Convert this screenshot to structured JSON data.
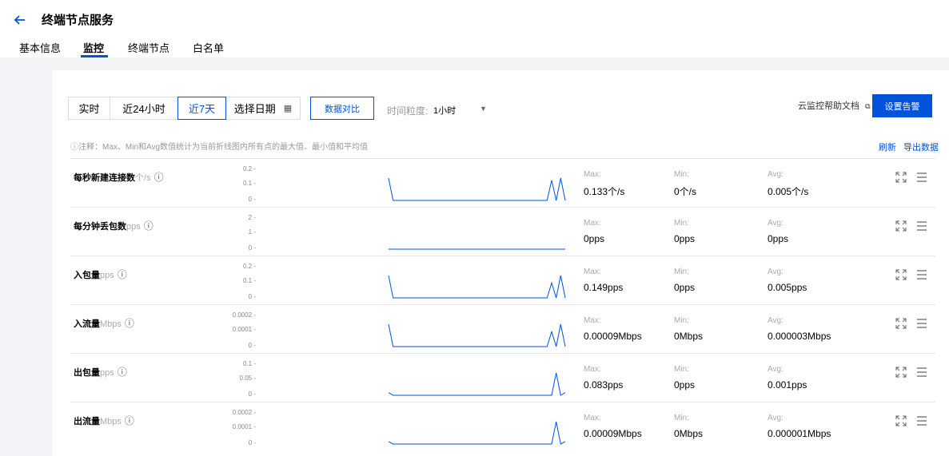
{
  "header": {
    "title": "终端节点服务",
    "tabs": [
      {
        "label": "基本信息"
      },
      {
        "label": "监控"
      },
      {
        "label": "终端节点"
      },
      {
        "label": "白名单"
      }
    ]
  },
  "toolbar": {
    "range_options": [
      {
        "label": "实时"
      },
      {
        "label": "近24小时"
      },
      {
        "label": "近7天"
      },
      {
        "label": "选择日期"
      }
    ],
    "compare_label": "数据对比",
    "granularity_label": "时间粒度:",
    "granularity_value": "1小时",
    "help_link": "云监控帮助文档",
    "alarm_button": "设置告警"
  },
  "note": "ⓘ注释：Max、Min和Avg数值统计为当前折线图内所有点的最大值、最小值和平均值",
  "actions": {
    "refresh": "刷新",
    "export": "导出数据"
  },
  "stat_labels": {
    "max": "Max:",
    "min": "Min:",
    "avg": "Avg:"
  },
  "accent_color": "#0052d9",
  "metrics": [
    {
      "name": "每秒新建连接数",
      "unit": "个/s",
      "ticks": [
        "0.2 -",
        "0.1 -",
        "0 -"
      ],
      "max": "0.133个/s",
      "min": "0个/s",
      "avg": "0.005个/s",
      "series": [
        0.133,
        0,
        0,
        0,
        0,
        0,
        0,
        0,
        0,
        0,
        0,
        0,
        0,
        0,
        0,
        0,
        0,
        0,
        0,
        0,
        0,
        0,
        0,
        0,
        0,
        0,
        0,
        0,
        0,
        0,
        0,
        0,
        0,
        0,
        0,
        0,
        0.12,
        0,
        0.133,
        0
      ]
    },
    {
      "name": "每分钟丢包数",
      "unit": "pps",
      "ticks": [
        "2 -",
        "1 -",
        "0 -"
      ],
      "max": "0pps",
      "min": "0pps",
      "avg": "0pps",
      "series": [
        0,
        0,
        0,
        0,
        0,
        0,
        0,
        0,
        0,
        0,
        0,
        0,
        0,
        0,
        0,
        0,
        0,
        0,
        0,
        0,
        0,
        0,
        0,
        0,
        0,
        0,
        0,
        0,
        0,
        0,
        0,
        0,
        0,
        0,
        0,
        0,
        0,
        0,
        0,
        0
      ]
    },
    {
      "name": "入包量",
      "unit": "pps",
      "ticks": [
        "0.2 -",
        "0.1 -",
        "0 -"
      ],
      "max": "0.149pps",
      "min": "0pps",
      "avg": "0.005pps",
      "series": [
        0.149,
        0,
        0,
        0,
        0,
        0,
        0,
        0,
        0,
        0,
        0,
        0,
        0,
        0,
        0,
        0,
        0,
        0,
        0,
        0,
        0,
        0,
        0,
        0,
        0,
        0,
        0,
        0,
        0,
        0,
        0,
        0,
        0,
        0,
        0,
        0,
        0.1,
        0,
        0.149,
        0
      ]
    },
    {
      "name": "入流量",
      "unit": "Mbps",
      "ticks": [
        "0.0002 -",
        "0.0001 -",
        "0 -"
      ],
      "max": "0.00009Mbps",
      "min": "0Mbps",
      "avg": "0.000003Mbps",
      "series": [
        9e-05,
        0,
        0,
        0,
        0,
        0,
        0,
        0,
        0,
        0,
        0,
        0,
        0,
        0,
        0,
        0,
        0,
        0,
        0,
        0,
        0,
        0,
        0,
        0,
        0,
        0,
        0,
        0,
        0,
        0,
        0,
        0,
        0,
        0,
        0,
        0,
        6e-05,
        0,
        9e-05,
        0
      ]
    },
    {
      "name": "出包量",
      "unit": "pps",
      "ticks": [
        "0.1 -",
        "0.05 -",
        "0 -"
      ],
      "max": "0.083pps",
      "min": "0pps",
      "avg": "0.001pps",
      "series": [
        0.01,
        0,
        0,
        0,
        0,
        0,
        0,
        0,
        0,
        0,
        0,
        0,
        0,
        0,
        0,
        0,
        0,
        0,
        0,
        0,
        0,
        0,
        0,
        0,
        0,
        0,
        0,
        0,
        0,
        0,
        0,
        0,
        0,
        0,
        0,
        0,
        0,
        0.083,
        0,
        0.01
      ]
    },
    {
      "name": "出流量",
      "unit": "Mbps",
      "ticks": [
        "0.0002 -",
        "0.0001 -",
        "0 -"
      ],
      "max": "0.00009Mbps",
      "min": "0Mbps",
      "avg": "0.000001Mbps",
      "series": [
        1e-05,
        0,
        0,
        0,
        0,
        0,
        0,
        0,
        0,
        0,
        0,
        0,
        0,
        0,
        0,
        0,
        0,
        0,
        0,
        0,
        0,
        0,
        0,
        0,
        0,
        0,
        0,
        0,
        0,
        0,
        0,
        0,
        0,
        0,
        0,
        0,
        0,
        9e-05,
        0,
        1e-05
      ]
    }
  ]
}
